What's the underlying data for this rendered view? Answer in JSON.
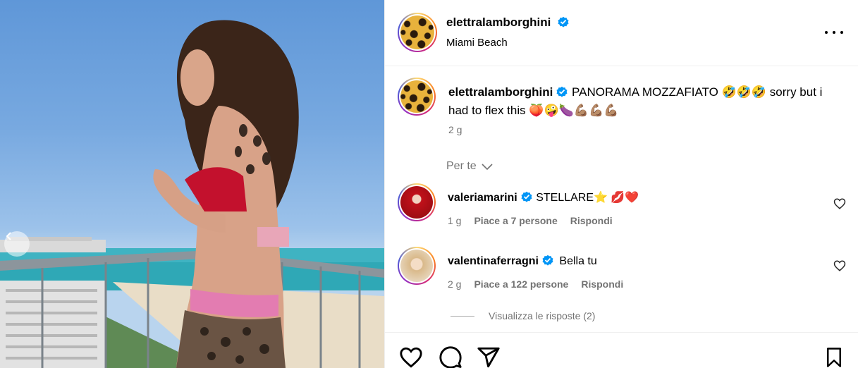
{
  "post": {
    "author": "elettralamborghini",
    "location": "Miami Beach",
    "caption_user": "elettralamborghini",
    "caption_text": "PANORAMA MOZZAFIATO 🤣🤣🤣 sorry but i had to flex this 🍑🤪🍆💪🏽💪🏽💪🏽",
    "caption_time": "2 g"
  },
  "comments_header": {
    "label": "Per te"
  },
  "comments": [
    {
      "user": "valeriamarini",
      "text": "STELLARE⭐️ 💋❤️",
      "time": "1 g",
      "likes": "Piace a 7 persone",
      "reply": "Rispondi"
    },
    {
      "user": "valentinaferragni",
      "text": "Bella tu",
      "time": "2 g",
      "likes": "Piace a 122 persone",
      "reply": "Rispondi"
    }
  ],
  "view_replies": "Visualizza le risposte (2)",
  "icons": {
    "verified": "verified-badge-icon",
    "more": "more-options-icon",
    "like": "heart-icon",
    "comment": "comment-icon",
    "share": "send-icon",
    "save": "bookmark-icon",
    "carousel": "carousel-prev-icon"
  },
  "colors": {
    "verified": "#0095f6",
    "secondary_text": "#737373",
    "divider": "#efefef"
  }
}
